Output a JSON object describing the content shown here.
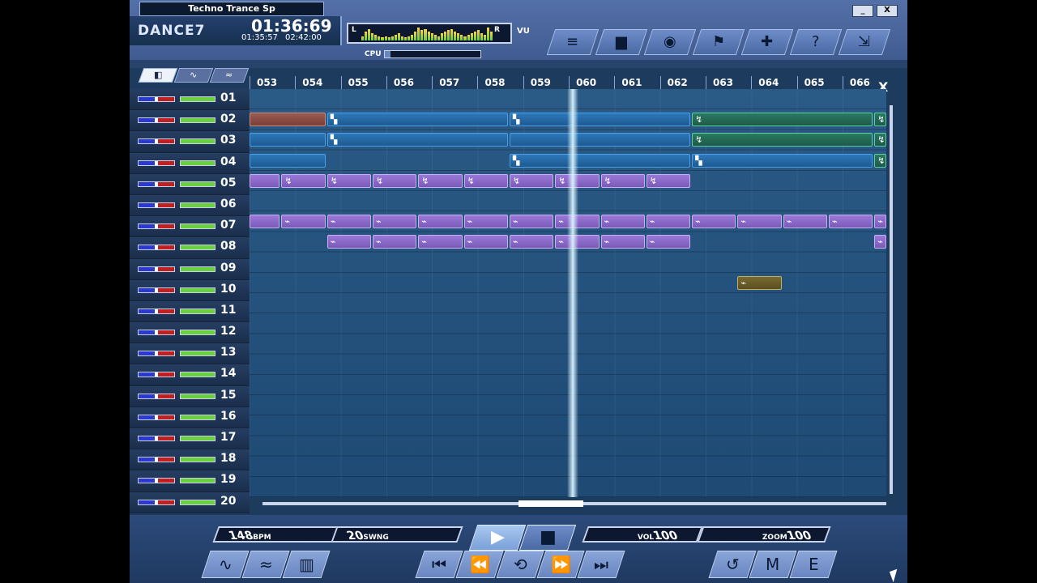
{
  "header": {
    "song_title": "Techno Trance Sp",
    "logo": "DANCE7",
    "time_main": "01:36:69",
    "time_elapsed": "01:35:57",
    "time_total": "02:42:00",
    "vu_left": "L",
    "vu_right": "R",
    "vu_label": "VU",
    "cpu_label": "CPU",
    "cpu_level": 0.06,
    "vu_levels": [
      0.3,
      0.6,
      0.8,
      0.5,
      0.4,
      0.3,
      0.2,
      0.3,
      0.2,
      0.3,
      0.4,
      0.5,
      0.3,
      0.2,
      0.3,
      0.4,
      0.6,
      0.9,
      0.7,
      0.8,
      0.6,
      0.5,
      0.4,
      0.3,
      0.5,
      0.6,
      0.7,
      0.8,
      0.6,
      0.5,
      0.4,
      0.3,
      0.4,
      0.5,
      0.6,
      0.7,
      0.5,
      0.4,
      0.9,
      0.6
    ]
  },
  "window_controls": [
    {
      "name": "minimize-button",
      "label": "_"
    },
    {
      "name": "close-button",
      "label": "X"
    }
  ],
  "toolbar": [
    {
      "name": "toolbar-list-button",
      "icon": "≡"
    },
    {
      "name": "toolbar-folder-button",
      "icon": "▆"
    },
    {
      "name": "toolbar-drum-button",
      "icon": "◉"
    },
    {
      "name": "toolbar-walk-button",
      "icon": "⚑"
    },
    {
      "name": "toolbar-puzzle-button",
      "icon": "✚"
    },
    {
      "name": "toolbar-help-button",
      "icon": "?"
    },
    {
      "name": "toolbar-expand-button",
      "icon": "⇲"
    }
  ],
  "tabs": [
    {
      "name": "tab-arrange",
      "icon": "◧",
      "active": true
    },
    {
      "name": "tab-sampler",
      "icon": "∿",
      "active": false
    },
    {
      "name": "tab-synth",
      "icon": "≈",
      "active": false
    }
  ],
  "ruler": [
    "053",
    "054",
    "055",
    "056",
    "057",
    "058",
    "059",
    "060",
    "061",
    "062",
    "063",
    "064",
    "065",
    "066"
  ],
  "tracks": [
    "01",
    "02",
    "03",
    "04",
    "05",
    "06",
    "07",
    "08",
    "09",
    "10",
    "11",
    "12",
    "13",
    "14",
    "15",
    "16",
    "17",
    "18",
    "19",
    "20"
  ],
  "clips": [
    {
      "track": 1,
      "start": 0,
      "span": 1.7,
      "color": "red",
      "icon": ""
    },
    {
      "track": 1,
      "start": 1.7,
      "span": 4,
      "color": "blue",
      "icon": "▚"
    },
    {
      "track": 1,
      "start": 5.7,
      "span": 4,
      "color": "blue",
      "icon": "▚"
    },
    {
      "track": 1,
      "start": 9.7,
      "span": 4,
      "color": "green",
      "icon": "↯"
    },
    {
      "track": 1,
      "start": 13.7,
      "span": 0.3,
      "color": "green",
      "icon": "↯"
    },
    {
      "track": 2,
      "start": 0,
      "span": 1.7,
      "color": "blue",
      "icon": ""
    },
    {
      "track": 2,
      "start": 1.7,
      "span": 4,
      "color": "blue",
      "icon": "▚"
    },
    {
      "track": 2,
      "start": 5.7,
      "span": 4,
      "color": "blue",
      "icon": ""
    },
    {
      "track": 2,
      "start": 9.7,
      "span": 4,
      "color": "green",
      "icon": "↯"
    },
    {
      "track": 2,
      "start": 13.7,
      "span": 0.3,
      "color": "green",
      "icon": "↯"
    },
    {
      "track": 3,
      "start": 0,
      "span": 1.7,
      "color": "blue",
      "icon": ""
    },
    {
      "track": 3,
      "start": 5.7,
      "span": 4,
      "color": "blue",
      "icon": "▚"
    },
    {
      "track": 3,
      "start": 9.7,
      "span": 4,
      "color": "blue",
      "icon": "▚"
    },
    {
      "track": 3,
      "start": 13.7,
      "span": 0.3,
      "color": "green",
      "icon": "↯"
    },
    {
      "track": 4,
      "start": 0,
      "span": 0.7,
      "color": "purple",
      "icon": ""
    },
    {
      "track": 4,
      "start": 0.7,
      "span": 1,
      "color": "purple",
      "icon": "↯"
    },
    {
      "track": 4,
      "start": 1.7,
      "span": 1,
      "color": "purple",
      "icon": "↯"
    },
    {
      "track": 4,
      "start": 2.7,
      "span": 1,
      "color": "purple",
      "icon": "↯"
    },
    {
      "track": 4,
      "start": 3.7,
      "span": 1,
      "color": "purple",
      "icon": "↯"
    },
    {
      "track": 4,
      "start": 4.7,
      "span": 1,
      "color": "purple",
      "icon": "↯"
    },
    {
      "track": 4,
      "start": 5.7,
      "span": 1,
      "color": "purple",
      "icon": "↯"
    },
    {
      "track": 4,
      "start": 6.7,
      "span": 1,
      "color": "purple",
      "icon": "↯"
    },
    {
      "track": 4,
      "start": 7.7,
      "span": 1,
      "color": "purple",
      "icon": "↯"
    },
    {
      "track": 4,
      "start": 8.7,
      "span": 1,
      "color": "purple",
      "icon": "↯"
    },
    {
      "track": 6,
      "start": 0,
      "span": 0.7,
      "color": "purple",
      "icon": ""
    },
    {
      "track": 6,
      "start": 0.7,
      "span": 1,
      "color": "purple",
      "icon": "⌁"
    },
    {
      "track": 6,
      "start": 1.7,
      "span": 1,
      "color": "purple",
      "icon": "⌁"
    },
    {
      "track": 6,
      "start": 2.7,
      "span": 1,
      "color": "purple",
      "icon": "⌁"
    },
    {
      "track": 6,
      "start": 3.7,
      "span": 1,
      "color": "purple",
      "icon": "⌁"
    },
    {
      "track": 6,
      "start": 4.7,
      "span": 1,
      "color": "purple",
      "icon": "⌁"
    },
    {
      "track": 6,
      "start": 5.7,
      "span": 1,
      "color": "purple",
      "icon": "⌁"
    },
    {
      "track": 6,
      "start": 6.7,
      "span": 1,
      "color": "purple",
      "icon": "⌁"
    },
    {
      "track": 6,
      "start": 7.7,
      "span": 1,
      "color": "purple",
      "icon": "⌁"
    },
    {
      "track": 6,
      "start": 8.7,
      "span": 1,
      "color": "purple",
      "icon": "⌁"
    },
    {
      "track": 6,
      "start": 9.7,
      "span": 1,
      "color": "purple",
      "icon": "⌁"
    },
    {
      "track": 6,
      "start": 10.7,
      "span": 1,
      "color": "purple",
      "icon": "⌁"
    },
    {
      "track": 6,
      "start": 11.7,
      "span": 1,
      "color": "purple",
      "icon": "⌁"
    },
    {
      "track": 6,
      "start": 12.7,
      "span": 1,
      "color": "purple",
      "icon": "⌁"
    },
    {
      "track": 6,
      "start": 13.7,
      "span": 0.3,
      "color": "purple",
      "icon": "⌁"
    },
    {
      "track": 7,
      "start": 1.7,
      "span": 1,
      "color": "purple",
      "icon": "⌁"
    },
    {
      "track": 7,
      "start": 2.7,
      "span": 1,
      "color": "purple",
      "icon": "⌁"
    },
    {
      "track": 7,
      "start": 3.7,
      "span": 1,
      "color": "purple",
      "icon": "⌁"
    },
    {
      "track": 7,
      "start": 4.7,
      "span": 1,
      "color": "purple",
      "icon": "⌁"
    },
    {
      "track": 7,
      "start": 5.7,
      "span": 1,
      "color": "purple",
      "icon": "⌁"
    },
    {
      "track": 7,
      "start": 6.7,
      "span": 1,
      "color": "purple",
      "icon": "⌁"
    },
    {
      "track": 7,
      "start": 7.7,
      "span": 1,
      "color": "purple",
      "icon": "⌁"
    },
    {
      "track": 7,
      "start": 8.7,
      "span": 1,
      "color": "purple",
      "icon": "⌁"
    },
    {
      "track": 7,
      "start": 13.7,
      "span": 0.3,
      "color": "purple",
      "icon": "⌁"
    },
    {
      "track": 9,
      "start": 10.7,
      "span": 1,
      "color": "olive",
      "icon": "⌁"
    }
  ],
  "bottom": {
    "bpm_value": "148",
    "bpm_unit": "BPM",
    "swing_value": "20",
    "swing_unit": "SWNG",
    "vol_label": "VOL",
    "vol_value": "100",
    "zoom_label": "ZOOM",
    "zoom_value": "100",
    "play_icon": "▶",
    "stop_icon": "■",
    "transport": [
      {
        "name": "skip-back-button",
        "icon": "⏮"
      },
      {
        "name": "rewind-button",
        "icon": "⏪"
      },
      {
        "name": "loop-button",
        "icon": "⟲"
      },
      {
        "name": "fast-forward-button",
        "icon": "⏩"
      },
      {
        "name": "skip-forward-button",
        "icon": "⏭"
      }
    ],
    "left_tools": [
      {
        "name": "wave-tool-button",
        "icon": "∿"
      },
      {
        "name": "sampler-tool-button",
        "icon": "≈"
      },
      {
        "name": "piano-tool-button",
        "icon": "▥"
      }
    ],
    "right_tools": [
      {
        "name": "record-tool-button",
        "icon": "↺"
      },
      {
        "name": "mixer-tool-button",
        "icon": "M"
      },
      {
        "name": "edit-tool-button",
        "icon": "E"
      }
    ]
  }
}
